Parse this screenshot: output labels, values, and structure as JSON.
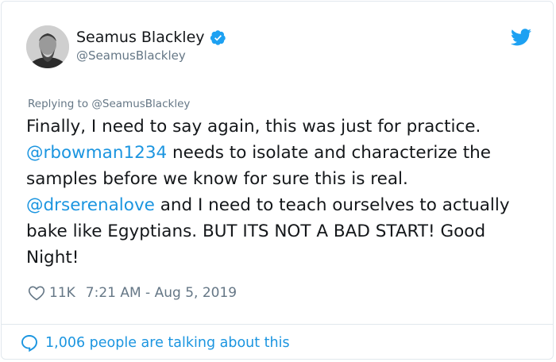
{
  "author": {
    "name": "Seamus Blackley",
    "handle": "@SeamusBlackley",
    "verified": true
  },
  "reply_context": {
    "prefix": "Replying to",
    "mention": "@SeamusBlackley"
  },
  "tweet": {
    "part1": "Finally, I need to say again, this was just for practice. ",
    "mention1": "@rbowman1234",
    "part2": " needs to isolate and characterize the samples before we know for sure this is real. ",
    "mention2": "@drserenalove",
    "part3": " and I need to teach ourselves to actually bake like Egyptians. BUT ITS NOT A BAD START! Good Night!"
  },
  "meta": {
    "likes": "11K",
    "timestamp": "7:21 AM - Aug 5, 2019"
  },
  "footer": {
    "talking": "1,006 people are talking about this"
  },
  "icons": {
    "verified": "verified-badge-icon",
    "bird": "twitter-bird-icon",
    "heart": "heart-outline-icon",
    "reply": "speech-bubble-icon"
  },
  "colors": {
    "link": "#1b95e0",
    "muted": "#657786",
    "text": "#14171a",
    "verified": "#1da1f2",
    "border": "#e1e8ed"
  }
}
